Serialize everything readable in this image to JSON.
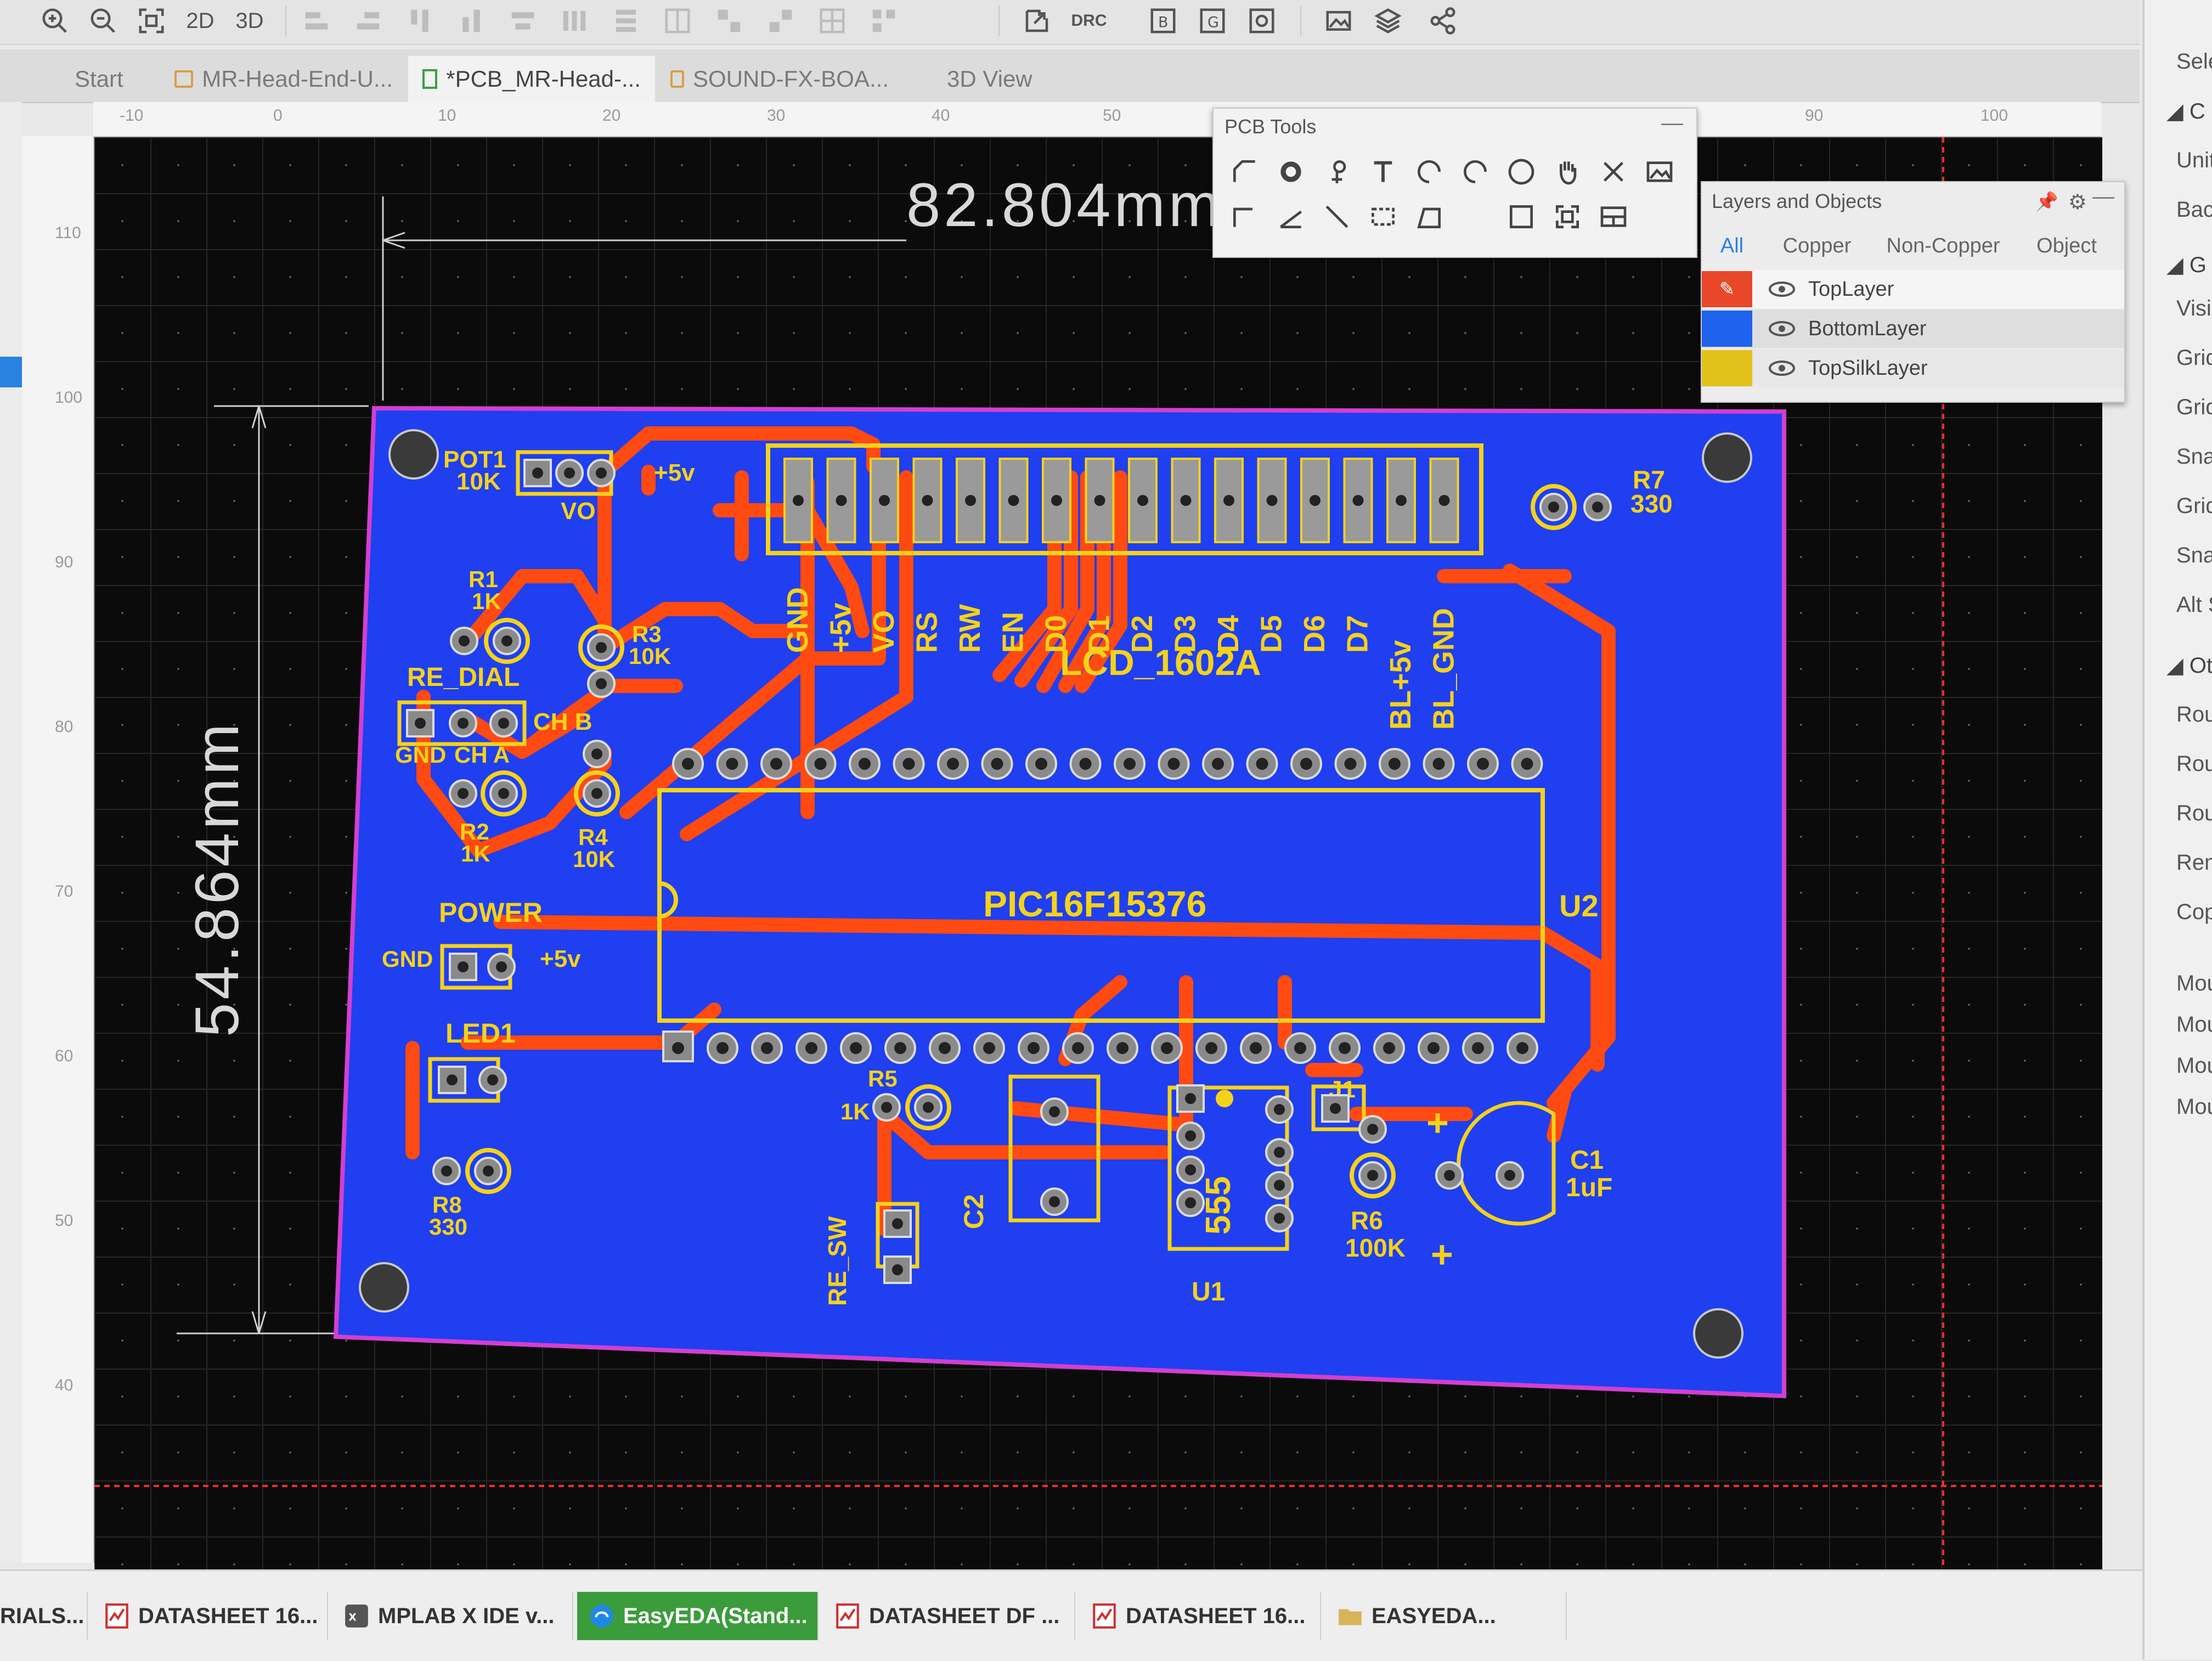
{
  "toolbar": {
    "zoom_in_icon": "zoom-in-icon",
    "zoom_out_icon": "zoom-out-icon",
    "fit_icon": "fit-view-icon",
    "view_2d": "2D",
    "view_3d": "3D",
    "drc": "DRC"
  },
  "tabs": [
    {
      "label": "Start"
    },
    {
      "label": "MR-Head-End-U..."
    },
    {
      "label": "*PCB_MR-Head-..."
    },
    {
      "label": "SOUND-FX-BOA..."
    },
    {
      "label": "3D View"
    }
  ],
  "ruler": {
    "top_ticks": [
      "-10",
      "0",
      "10",
      "20",
      "30",
      "40",
      "50",
      "90",
      "100"
    ],
    "left_ticks": [
      "110",
      "100",
      "90",
      "80",
      "70",
      "60",
      "50",
      "40"
    ]
  },
  "pcb_tools": {
    "title": "PCB Tools",
    "minimize": "—"
  },
  "layers_panel": {
    "title": "Layers and Objects",
    "tabs": [
      "All",
      "Copper",
      "Non-Copper",
      "Object"
    ],
    "layers": [
      {
        "name": "TopLayer",
        "color": "#e8472a"
      },
      {
        "name": "BottomLayer",
        "color": "#1f62ee"
      },
      {
        "name": "TopSilkLayer",
        "color": "#e2c21a"
      }
    ]
  },
  "right_panel": {
    "items": [
      "Sele",
      "C",
      "Unit",
      "Bac",
      "G",
      "Visi",
      "Grid",
      "Grid",
      "Sna",
      "Grid",
      "Snap",
      "Alt S",
      "Ot",
      "Rout",
      "Rout",
      "Rout",
      "Rem",
      "Copp",
      "Mous",
      "Mous",
      "Mous",
      "Mous"
    ]
  },
  "board": {
    "dimension_width": "82.804mm",
    "dimension_height": "54.864mm",
    "labels": {
      "pot1": "POT1",
      "pot1_val": "10K",
      "plus5v_a": "+5v",
      "vo": "VO",
      "r1": "R1",
      "r1_val": "1K",
      "r3": "R3",
      "r3_val": "10K",
      "re_dial": "RE_DIAL",
      "ch_b": "CH B",
      "gnd_a": "GND",
      "ch_a": "CH A",
      "r2": "R2",
      "r2_val": "1K",
      "r4": "R4",
      "r4_val": "10K",
      "power": "POWER",
      "gnd_b": "GND",
      "plus5v_b": "+5v",
      "led1": "LED1",
      "r8": "R8",
      "r8_val": "330",
      "r7": "R7",
      "r7_val": "330",
      "lcd": "LCD_1602A",
      "mcu": "PIC16F15376",
      "u2": "U2",
      "r5": "R5",
      "r5_val": "1K",
      "c2": "C2",
      "u1_chip": "555",
      "u1": "U1",
      "j1": "J1",
      "r6": "R6",
      "r6_val": "100K",
      "c1": "C1",
      "c1_val": "1uF",
      "plus_a": "+",
      "plus_b": "+",
      "re_sw": "RE_SW"
    },
    "lcd_pins": [
      "GND",
      "+5v",
      "VO",
      "RS",
      "RW",
      "EN",
      "D0",
      "D1",
      "D2",
      "D3",
      "D4",
      "D5",
      "D6",
      "D7",
      "BL+5v",
      "BL_GND"
    ],
    "colors": {
      "board": "#1f3ff0",
      "copper": "#ff4a12",
      "silk": "#f5d21a",
      "outline": "#d33fd0"
    }
  },
  "taskbar": [
    {
      "label": "RIALS..."
    },
    {
      "label": "DATASHEET 16..."
    },
    {
      "label": "MPLAB X IDE v..."
    },
    {
      "label": "EasyEDA(Stand..."
    },
    {
      "label": "DATASHEET DF ..."
    },
    {
      "label": "DATASHEET 16..."
    },
    {
      "label": "EASYEDA..."
    }
  ]
}
